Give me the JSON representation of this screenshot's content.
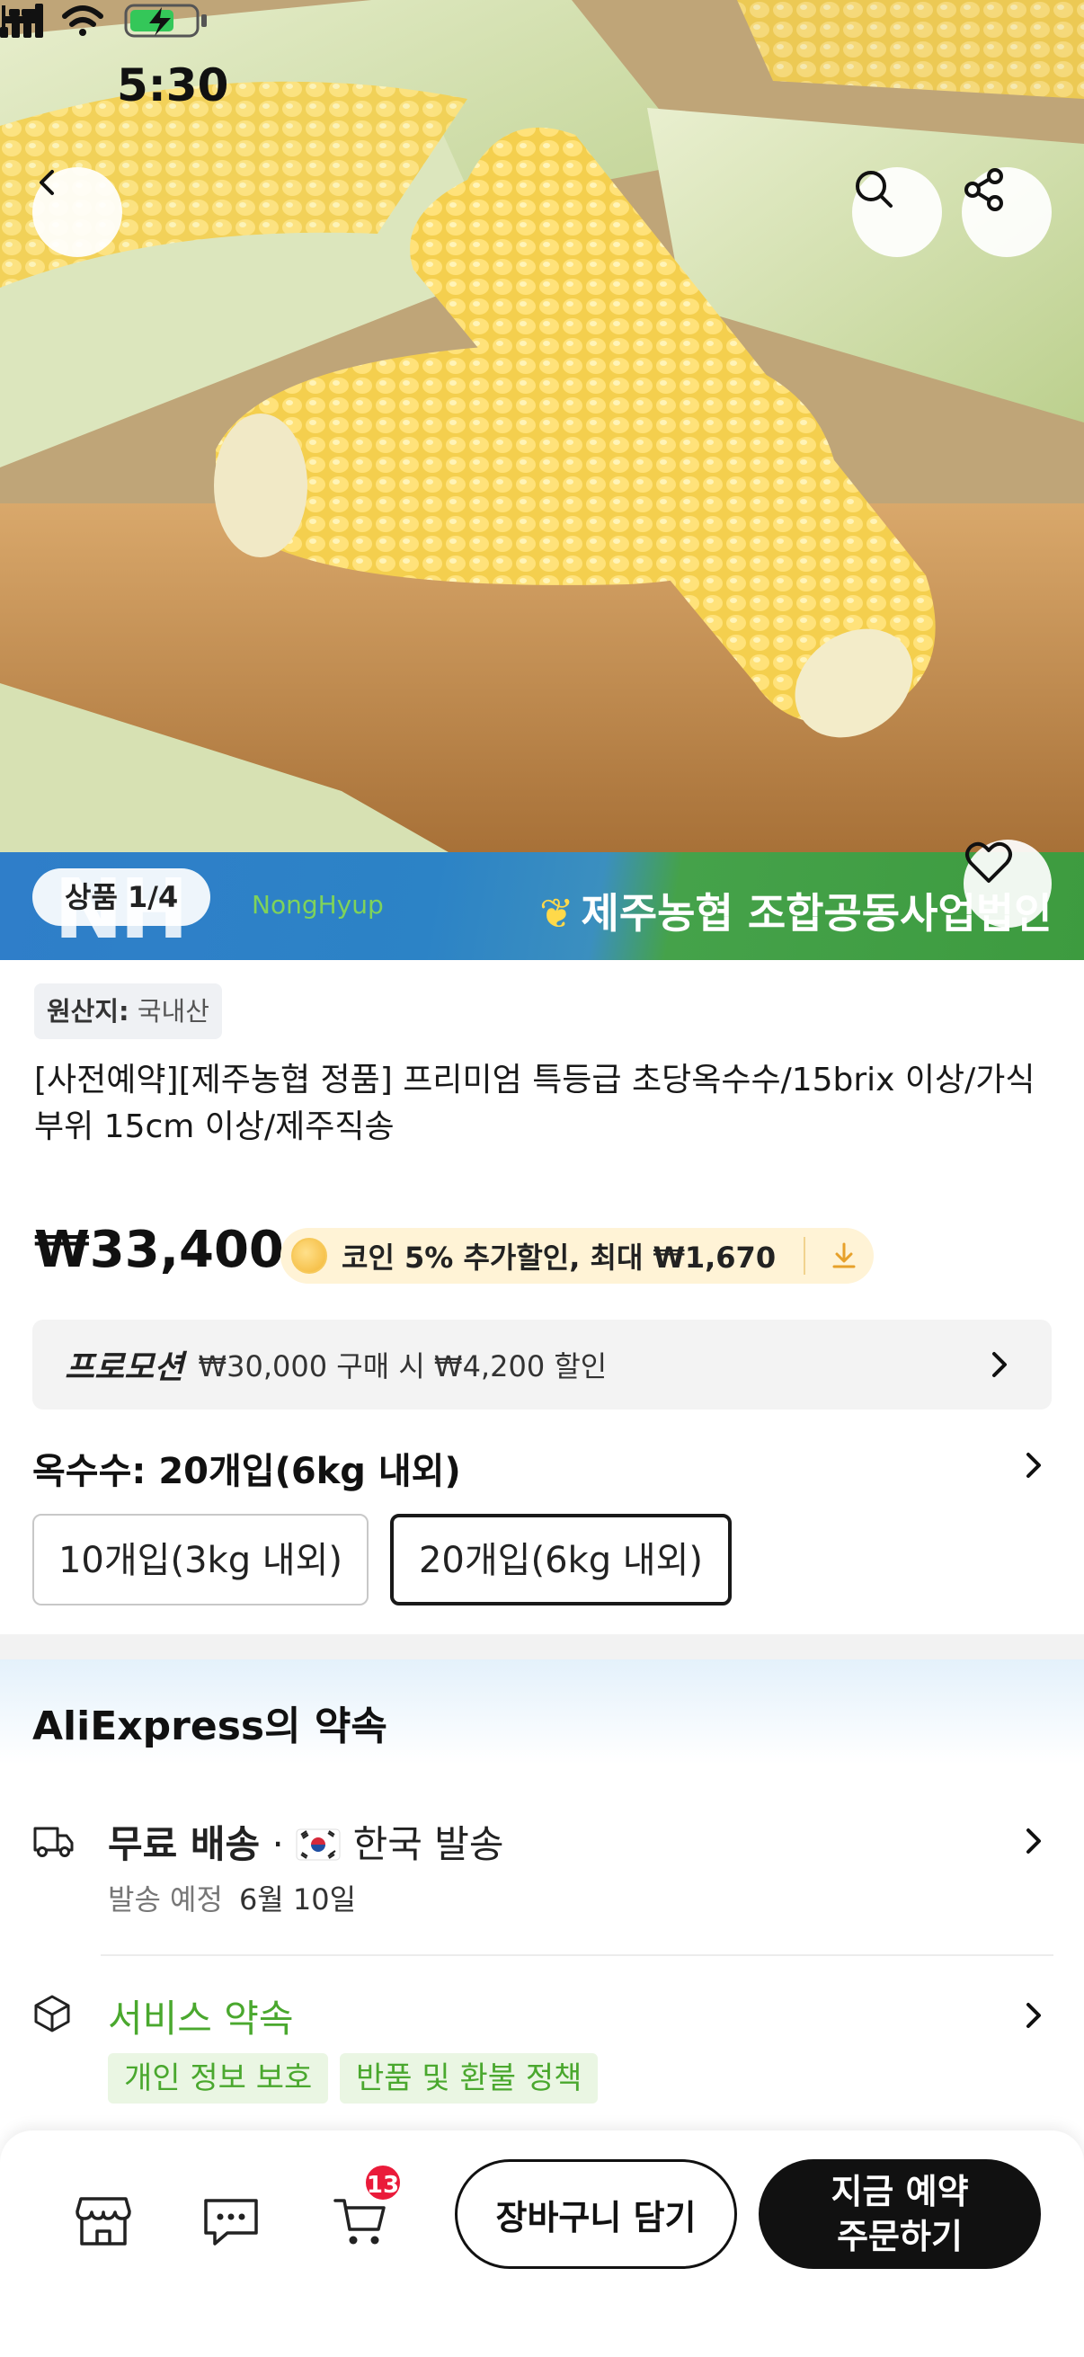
{
  "status_bar": {
    "time": "5:30"
  },
  "gallery": {
    "pager": "상품 1/4"
  },
  "banner": {
    "nh": "NH",
    "nonghyup": "NongHyup",
    "jeju": "제주농협 조합공동사업법인"
  },
  "product": {
    "origin_label": "원산지:",
    "origin_value": "국내산",
    "title": "[사전예약][제주농협 정품] 프리미엄 특등급 초당옥수수/15brix 이상/가식부위 15cm 이상/제주직송",
    "price": "₩33,400",
    "coin_text": "코인 5% 추가할인, 최대 ₩1,670"
  },
  "promotion": {
    "label": "프로모션",
    "text": "₩30,000 구매 시 ₩4,200 할인"
  },
  "variant": {
    "title": "옥수수: 20개입(6kg 내외)",
    "options": [
      "10개입(3kg 내외)",
      "20개입(6kg 내외)"
    ],
    "selected": "20개입(6kg 내외)"
  },
  "promise": {
    "title": "AliExpress의 약속",
    "shipping_label": "무료 배송",
    "shipping_origin": "한국 발송",
    "shipping_sub_label": "발송 예정",
    "shipping_date": "6월 10일",
    "service_label": "서비스 약속",
    "tags": [
      "개인 정보 보호",
      "반품 및 환불 정책"
    ]
  },
  "bottom_bar": {
    "cart_count": "13",
    "add_to_cart": "장바구니 담기",
    "order_line1": "지금 예약",
    "order_line2": "주문하기"
  },
  "colors": {
    "accent_green": "#4aa82e",
    "badge_red": "#ea1b3a",
    "coin_bg": "#fff3d6"
  },
  "icons": [
    "back-arrow-icon",
    "search-icon",
    "share-icon",
    "heart-icon",
    "coin-icon",
    "download-icon",
    "chevron-right-icon",
    "truck-icon",
    "korea-flag-icon",
    "box-icon",
    "store-icon",
    "chat-icon",
    "cart-icon"
  ]
}
